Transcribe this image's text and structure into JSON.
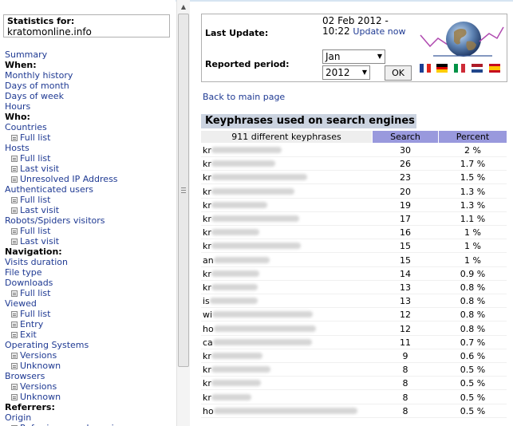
{
  "menu": {
    "statistics_for_label": "Statistics for:",
    "site": "kratomonline.info",
    "items": [
      {
        "label": "Summary",
        "type": "link",
        "top": 0
      },
      {
        "label": "When:",
        "type": "head"
      },
      {
        "label": "Monthly history",
        "type": "link"
      },
      {
        "label": "Days of month",
        "type": "link"
      },
      {
        "label": "Days of week",
        "type": "link"
      },
      {
        "label": "Hours",
        "type": "link"
      },
      {
        "label": "Who:",
        "type": "head"
      },
      {
        "label": "Countries",
        "type": "link"
      },
      {
        "label": "Full list",
        "type": "sub"
      },
      {
        "label": "Hosts",
        "type": "link"
      },
      {
        "label": "Full list",
        "type": "sub"
      },
      {
        "label": "Last visit",
        "type": "sub"
      },
      {
        "label": "Unresolved IP Address",
        "type": "sub"
      },
      {
        "label": "Authenticated users",
        "type": "link"
      },
      {
        "label": "Full list",
        "type": "sub"
      },
      {
        "label": "Last visit",
        "type": "sub"
      },
      {
        "label": "Robots/Spiders visitors",
        "type": "link"
      },
      {
        "label": "Full list",
        "type": "sub"
      },
      {
        "label": "Last visit",
        "type": "sub"
      },
      {
        "label": "Navigation:",
        "type": "head"
      },
      {
        "label": "Visits duration",
        "type": "link"
      },
      {
        "label": "File type",
        "type": "link"
      },
      {
        "label": "Downloads",
        "type": "link"
      },
      {
        "label": "Full list",
        "type": "sub"
      },
      {
        "label": "Viewed",
        "type": "link"
      },
      {
        "label": "Full list",
        "type": "sub"
      },
      {
        "label": "Entry",
        "type": "sub"
      },
      {
        "label": "Exit",
        "type": "sub"
      },
      {
        "label": "Operating Systems",
        "type": "link"
      },
      {
        "label": "Versions",
        "type": "sub"
      },
      {
        "label": "Unknown",
        "type": "sub"
      },
      {
        "label": "Browsers",
        "type": "link"
      },
      {
        "label": "Versions",
        "type": "sub"
      },
      {
        "label": "Unknown",
        "type": "sub"
      },
      {
        "label": "Referrers:",
        "type": "head"
      },
      {
        "label": "Origin",
        "type": "link"
      },
      {
        "label": "Referring search engines",
        "type": "sub"
      }
    ]
  },
  "info": {
    "last_update_label": "Last Update:",
    "last_update_value": "02 Feb 2012 - 10:22",
    "update_now_label": "Update now",
    "reported_period_label": "Reported period:",
    "month_selected": "Jan",
    "year_selected": "2012",
    "ok_label": "OK"
  },
  "back_link": "Back to main page",
  "keyphrases": {
    "title": "Keyphrases used on search engines",
    "count_label": "911 different keyphrases",
    "search_header": "Search",
    "percent_header": "Percent",
    "rows": [
      {
        "prefix": "kr",
        "search": "30",
        "percent": "2 %"
      },
      {
        "prefix": "kr",
        "search": "26",
        "percent": "1.7 %"
      },
      {
        "prefix": "kr",
        "search": "23",
        "percent": "1.5 %"
      },
      {
        "prefix": "kr",
        "search": "20",
        "percent": "1.3 %"
      },
      {
        "prefix": "kr",
        "search": "19",
        "percent": "1.3 %"
      },
      {
        "prefix": "kr",
        "search": "17",
        "percent": "1.1 %"
      },
      {
        "prefix": "kr",
        "search": "16",
        "percent": "1 %"
      },
      {
        "prefix": "kr",
        "search": "15",
        "percent": "1 %"
      },
      {
        "prefix": "an",
        "search": "15",
        "percent": "1 %"
      },
      {
        "prefix": "kr",
        "search": "14",
        "percent": "0.9 %"
      },
      {
        "prefix": "kr",
        "search": "13",
        "percent": "0.8 %"
      },
      {
        "prefix": "is",
        "search": "13",
        "percent": "0.8 %"
      },
      {
        "prefix": "wi",
        "search": "12",
        "percent": "0.8 %"
      },
      {
        "prefix": "ho",
        "search": "12",
        "percent": "0.8 %"
      },
      {
        "prefix": "ca",
        "search": "11",
        "percent": "0.7 %"
      },
      {
        "prefix": "kr",
        "search": "9",
        "percent": "0.6 %"
      },
      {
        "prefix": "kr",
        "search": "8",
        "percent": "0.5 %"
      },
      {
        "prefix": "kr",
        "search": "8",
        "percent": "0.5 %"
      },
      {
        "prefix": "kr",
        "search": "8",
        "percent": "0.5 %"
      },
      {
        "prefix": "ho",
        "search": "8",
        "percent": "0.5 %"
      }
    ]
  },
  "colors": {
    "link": "#1f3a93",
    "section_title_bg": "#cbd3e0",
    "column_header_bg": "#9999dd"
  }
}
